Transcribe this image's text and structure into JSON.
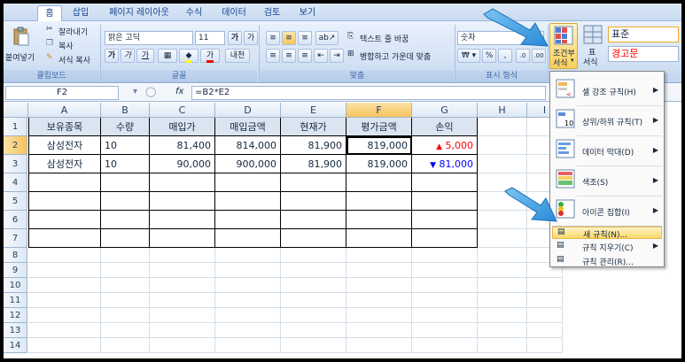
{
  "tabs": [
    "홈",
    "삽입",
    "페이지 레이아웃",
    "수식",
    "데이터",
    "검토",
    "보기"
  ],
  "ribbon": {
    "paste": "붙여넣기",
    "cut": "잘라내기",
    "copy": "복사",
    "format_painter": "서식 복사",
    "clipboard_label": "클립보드",
    "font_name": "맑은 고딕",
    "font_size": "11",
    "font_grow": "가",
    "font_shrink": "가",
    "bold": "가",
    "italic": "가",
    "underline": "가",
    "font_color": "가",
    "phonetic": "내천",
    "font_label": "글꼴",
    "wrap_text": "텍스트 줄 바꿈",
    "merge_center": "병합하고 가운데 맞춤",
    "align_label": "맞춤",
    "number_format": "숫자",
    "percent": "%",
    "comma": ",",
    "number_label": "표시 형식",
    "cond_format_1": "조건부",
    "cond_format_2": "서식",
    "table_1": "표",
    "table_2": "서식",
    "style_normal": "표준",
    "style_warning": "경고문"
  },
  "formula_bar": {
    "cell_ref": "F2",
    "fx": "fx",
    "formula": "=B2*E2"
  },
  "columns": [
    "A",
    "B",
    "C",
    "D",
    "E",
    "F",
    "G",
    "H",
    "I"
  ],
  "rows": [
    "1",
    "2",
    "3",
    "4",
    "5",
    "6",
    "7",
    "8",
    "9",
    "10",
    "11",
    "12",
    "13",
    "14"
  ],
  "table": {
    "headers": [
      "보유종목",
      "수량",
      "매입가",
      "매입금액",
      "현재가",
      "평가금액",
      "손익"
    ],
    "data": [
      [
        "삼성전자",
        "10",
        "81,400",
        "814,000",
        "81,900",
        "819,000",
        "5,000"
      ],
      [
        "삼성전자",
        "10",
        "90,000",
        "900,000",
        "81,900",
        "819,000",
        "81,000"
      ]
    ],
    "up_symbol": "▲",
    "down_symbol": "▼",
    "up_color": "#ff0000",
    "down_color": "#0000ff"
  },
  "menu": {
    "items": [
      {
        "label": "셀 강조 규칙(H)"
      },
      {
        "label": "상위/하위 규칙(T)"
      },
      {
        "label": "데이터 막대(D)"
      },
      {
        "label": "색조(S)"
      },
      {
        "label": "아이콘 집합(I)"
      }
    ],
    "subs": [
      {
        "label": "새 규칙(N)..."
      },
      {
        "label": "규칙 지우기(C)"
      },
      {
        "label": "규칙 관리(R)..."
      }
    ]
  },
  "colors": {
    "accent_arrow": "#4aa3df",
    "selected_header": "#f6c35e",
    "table_header_fill": "#dbe5f1"
  }
}
